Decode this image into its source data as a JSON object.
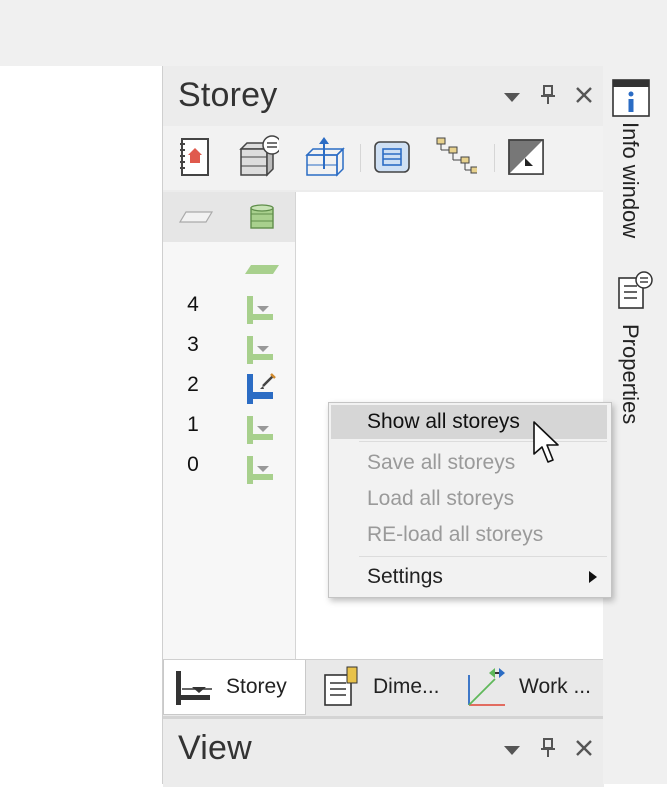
{
  "storey_panel": {
    "title": "Storey",
    "storeys": [
      {
        "label": ""
      },
      {
        "label": "4"
      },
      {
        "label": "3"
      },
      {
        "label": "2"
      },
      {
        "label": "1"
      },
      {
        "label": "0"
      }
    ],
    "current_storey": "2",
    "tabs": [
      {
        "label": "Storey",
        "active": true
      },
      {
        "label": "Dime...",
        "active": false
      },
      {
        "label": "Work ...",
        "active": false
      }
    ]
  },
  "view_panel": {
    "title": "View"
  },
  "context_menu": {
    "items": [
      {
        "label": "Show all storeys",
        "state": "hover"
      },
      {
        "label": "Save all storeys",
        "state": "disabled"
      },
      {
        "label": "Load all storeys",
        "state": "disabled"
      },
      {
        "label": "RE-load all storeys",
        "state": "disabled"
      },
      {
        "label": "Settings",
        "state": "normal",
        "submenu": true
      }
    ]
  },
  "sidebar": {
    "tabs": [
      {
        "label": "Info window",
        "icon": "info-icon"
      },
      {
        "label": "Properties",
        "icon": "properties-icon"
      }
    ]
  },
  "colors": {
    "accent_blue": "#2b6cc4",
    "storey_green": "#a8d08d",
    "menu_hover": "#d6d6d6"
  }
}
